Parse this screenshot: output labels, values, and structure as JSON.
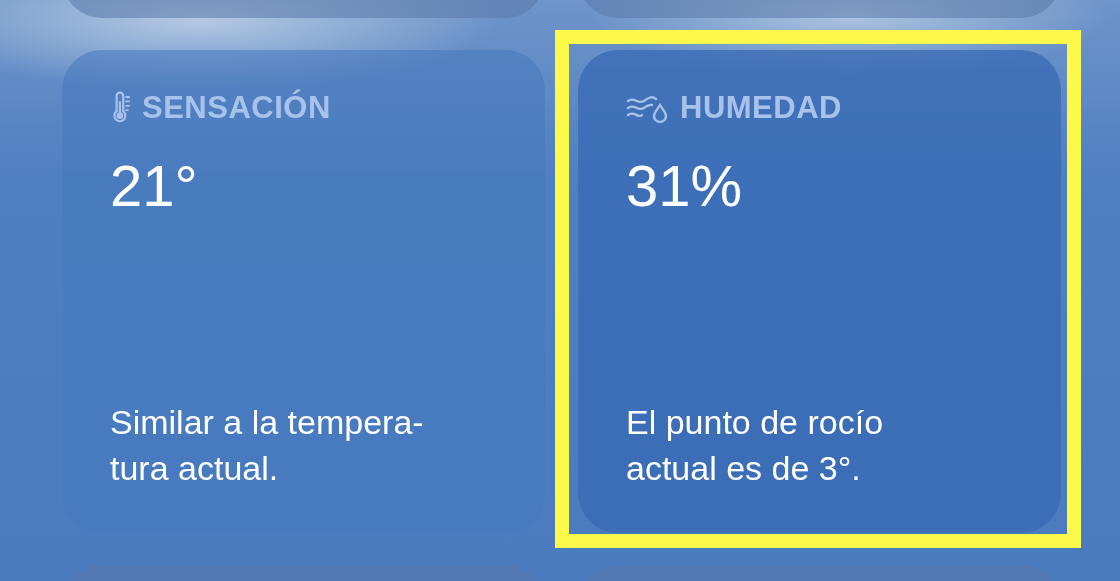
{
  "cards": [
    {
      "kind": "feels_like",
      "label": "SENSACIÓN",
      "value": "21°",
      "description": "Similar a la tempera-\ntura actual.",
      "highlighted": false
    },
    {
      "kind": "humidity",
      "label": "HUMEDAD",
      "value": "31%",
      "description": "El punto de rocío\nactual es de 3°.",
      "highlighted": true
    }
  ]
}
